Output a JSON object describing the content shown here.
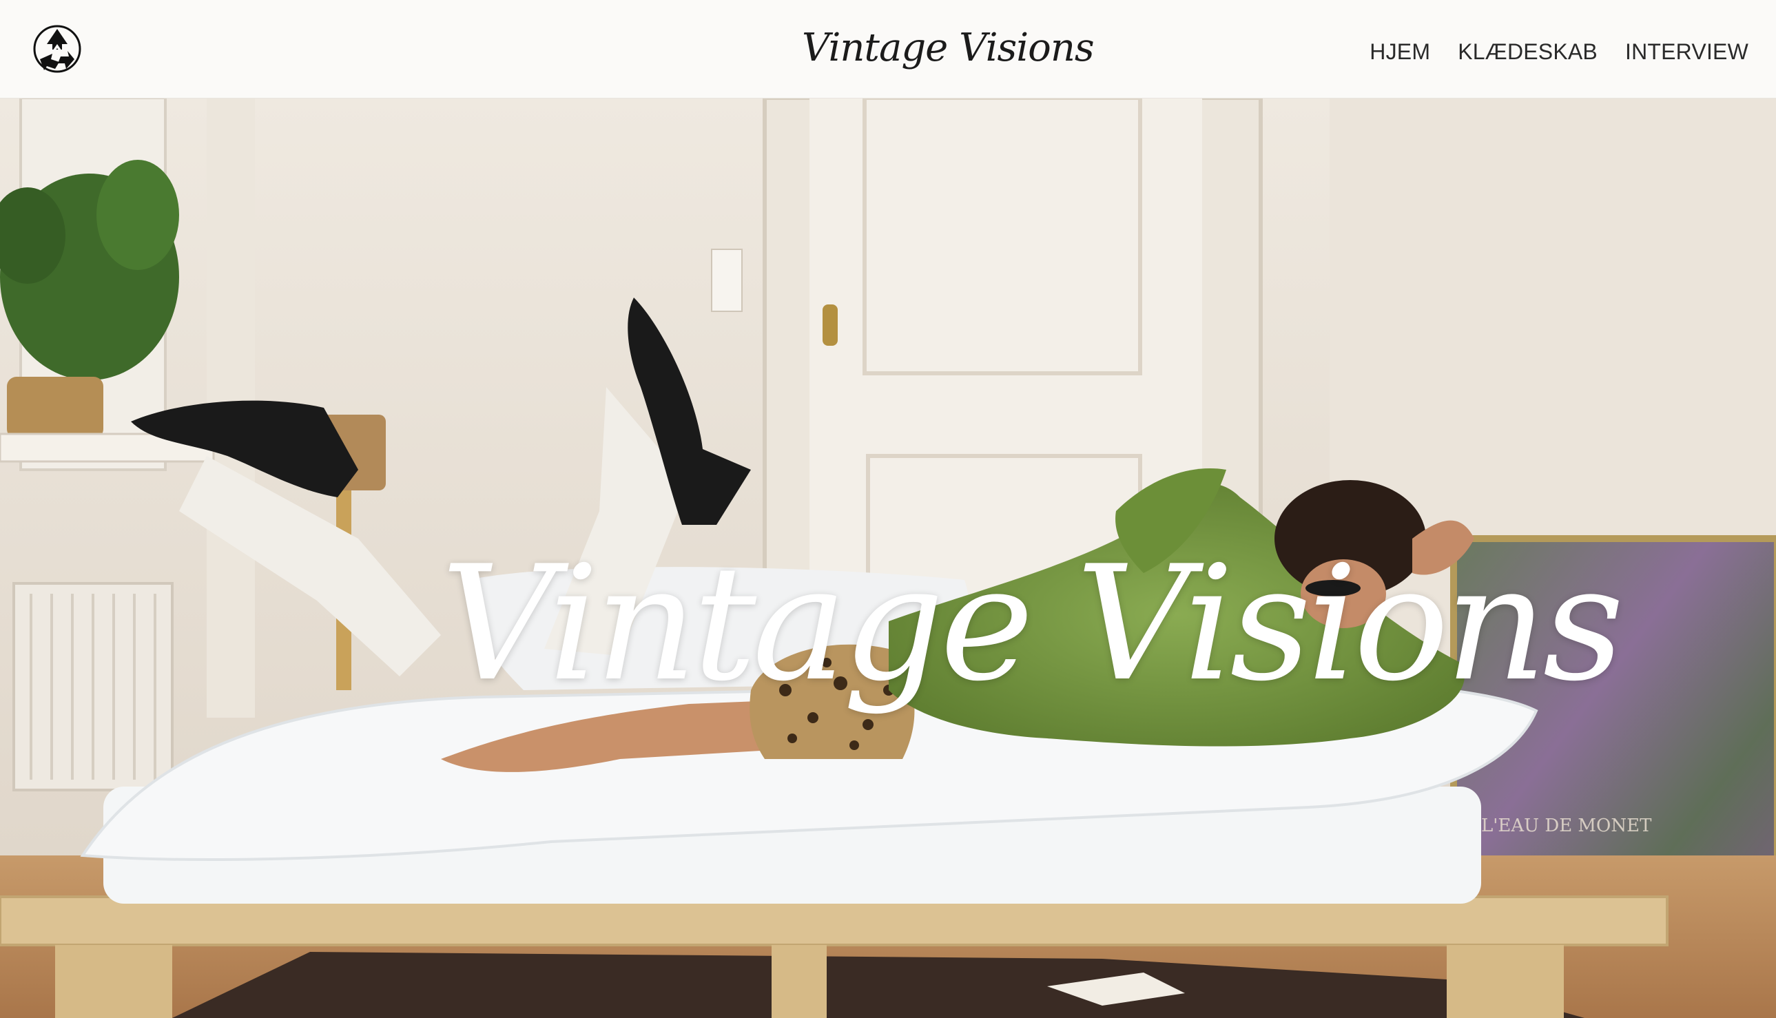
{
  "header": {
    "logo_icon": "recycle-arrows-icon",
    "brand": "Vintage Visions"
  },
  "nav": {
    "items": [
      {
        "label": "HJEM"
      },
      {
        "label": "KLÆDESKAB"
      },
      {
        "label": "INTERVIEW"
      }
    ]
  },
  "hero": {
    "title": "Vintage Visions",
    "poster_caption": "L'EAU DE MONET"
  },
  "colors": {
    "header_bg": "#fbfaf8",
    "wall": "#e6ded3",
    "coat_green": "#7a9a45",
    "bed_wood": "#d8bc8a",
    "title_text": "#ffffff"
  }
}
